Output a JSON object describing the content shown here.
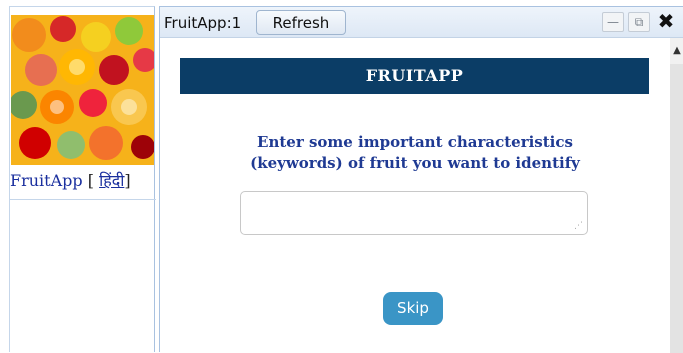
{
  "sidebar": {
    "app_link": "FruitApp",
    "bracket_open": "[",
    "hindi_link": "हिंदी",
    "bracket_close": "]"
  },
  "window": {
    "title": "FruitApp:1",
    "refresh_label": "Refresh",
    "minimize_icon": "minimize-icon",
    "popout_icon": "popout-icon",
    "close_icon": "close-icon"
  },
  "main": {
    "banner_title": "FRUITAPP",
    "prompt_line1": "Enter some important characteristics",
    "prompt_line2": "(keywords) of fruit you want to identify",
    "keywords_value": "",
    "skip_label": "Skip"
  },
  "colors": {
    "banner_bg": "#0b3d66",
    "prompt_text": "#1f3a93",
    "skip_bg": "#3a95c6"
  }
}
